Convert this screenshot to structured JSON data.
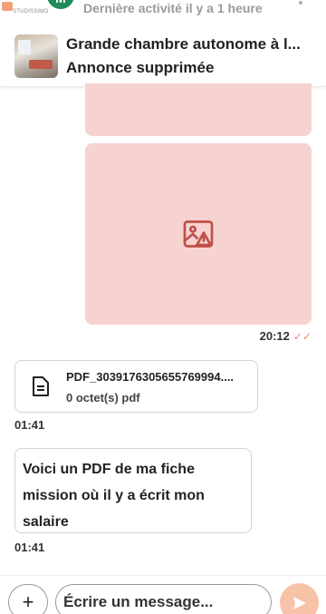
{
  "header": {
    "logo_text": "STUDISSIMO",
    "avatar_initial": "M",
    "last_activity": "Dernière activité il y a 1 heure"
  },
  "listing": {
    "title": "Grande chambre autonome à l...",
    "status": "Annonce supprimée"
  },
  "messages": {
    "image_time": "20:12",
    "pdf": {
      "file_name": "PDF_3039176305655769994....",
      "file_size": "0 octet(s) pdf",
      "time": "01:41"
    },
    "text": {
      "line1": "Voici un PDF de ma fiche",
      "line2": "mission où il y a écrit mon",
      "line3": "salaire",
      "time": "01:41"
    }
  },
  "composer": {
    "add_label": "+",
    "placeholder": "Écrire un message..."
  },
  "colors": {
    "bubble_image": "#f6d3d0",
    "accent": "#e88a6a",
    "send": "#f7c3a8"
  },
  "icons": [
    "broken-image-icon",
    "check-double-icon",
    "document-icon",
    "plus-icon",
    "send-icon"
  ]
}
